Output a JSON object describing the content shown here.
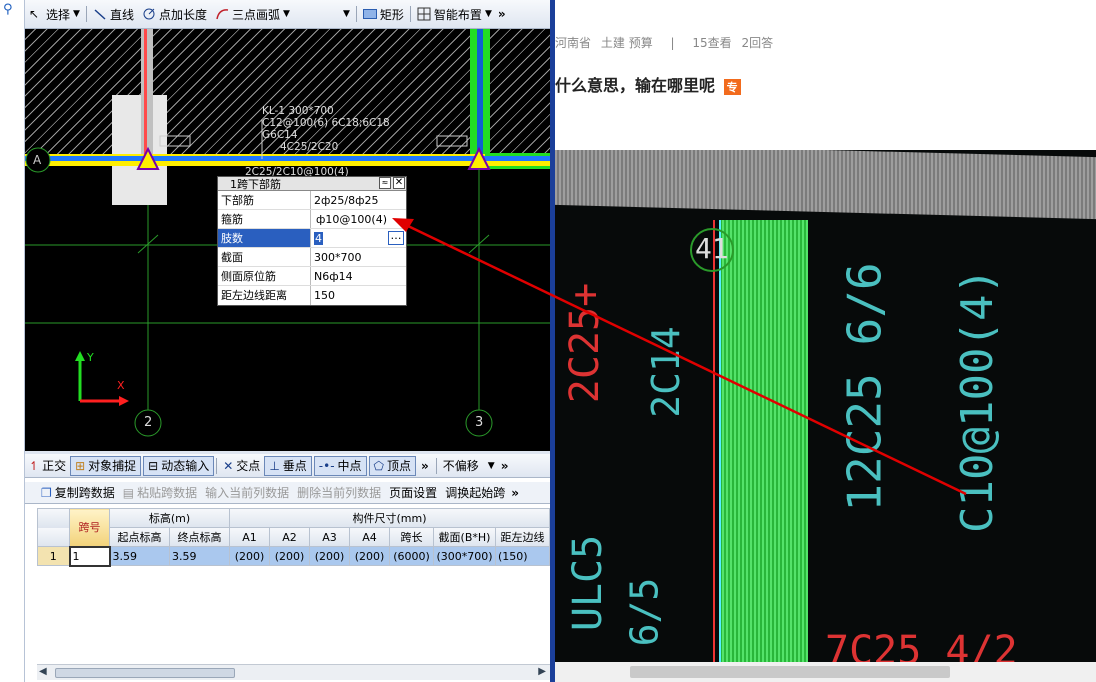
{
  "toolbar": {
    "select": "选择",
    "line": "直线",
    "point_length": "点加长度",
    "arc": "三点画弧",
    "rect": "矩形",
    "smart_layout": "智能布置",
    "more": "»"
  },
  "cad": {
    "axis_a": "A",
    "axis_2": "2",
    "axis_3": "3",
    "y_label": "Y",
    "x_label": "X",
    "annot_lines": [
      "KL-1 300*700",
      "C12@100(6) 6C18;6C18",
      "G6C14",
      "4C25/2C20"
    ],
    "annot_bottom": "2C25/2C10@100(4)"
  },
  "prop_panel": {
    "title": "1跨下部筋",
    "rows": [
      {
        "key": "下部筋",
        "value": "2ф25/8ф25"
      },
      {
        "key": "箍筋",
        "value": "ф10@100(4)"
      },
      {
        "key": "肢数",
        "value": "4"
      },
      {
        "key": "截面",
        "value": "300*700"
      },
      {
        "key": "侧面原位筋",
        "value": "N6ф14"
      },
      {
        "key": "距左边线距离",
        "value": "150"
      }
    ]
  },
  "snap_bar": {
    "ortho": "正交",
    "osnap": "对象捕捉",
    "dynamic_input": "动态输入",
    "intersection": "交点",
    "perpendicular": "垂点",
    "midpoint": "中点",
    "vertex": "顶点",
    "more": "»",
    "offset": "不偏移",
    "more2": "»"
  },
  "grid_toolbar": {
    "copy": "复制跨数据",
    "paste": "粘贴跨数据",
    "input_current": "输入当前列数据",
    "delete_current": "删除当前列数据",
    "page_setup": "页面设置",
    "swap_start": "调换起始跨",
    "more": "»"
  },
  "grid": {
    "col_span": "跨号",
    "group_elev": "标高(m)",
    "group_size": "构件尺寸(mm)",
    "subheaders": [
      "起点标高",
      "终点标高",
      "A1",
      "A2",
      "A3",
      "A4",
      "跨长",
      "截面(B*H)",
      "距左边线"
    ],
    "row": {
      "num": "1",
      "span": "1",
      "cells": [
        "3.59",
        "3.59",
        "(200)",
        "(200)",
        "(200)",
        "(200)",
        "(6000)",
        "(300*700)",
        "(150)"
      ]
    }
  },
  "page": {
    "breadcrumb": [
      "河南省",
      "土建",
      "预算"
    ],
    "divider": "|",
    "views": "15查看",
    "answers": "2回答",
    "title_text": "什么意思，输在哪里呢",
    "title_badge": "专"
  },
  "photo": {
    "text_red_1": "2C25+",
    "text_blue_1": "2C14",
    "axis_num": "41",
    "text_blue_2": "12C25 6/6",
    "text_blue_3": "C10@100(4)",
    "text_blue_4": "ULC5",
    "text_blue_5": "6/5",
    "text_red_2": "7C25 4/2"
  },
  "colors": {
    "accent": "#1f5fbf",
    "green": "#22dd22",
    "yellow": "#ffee00",
    "red": "#e00000"
  }
}
